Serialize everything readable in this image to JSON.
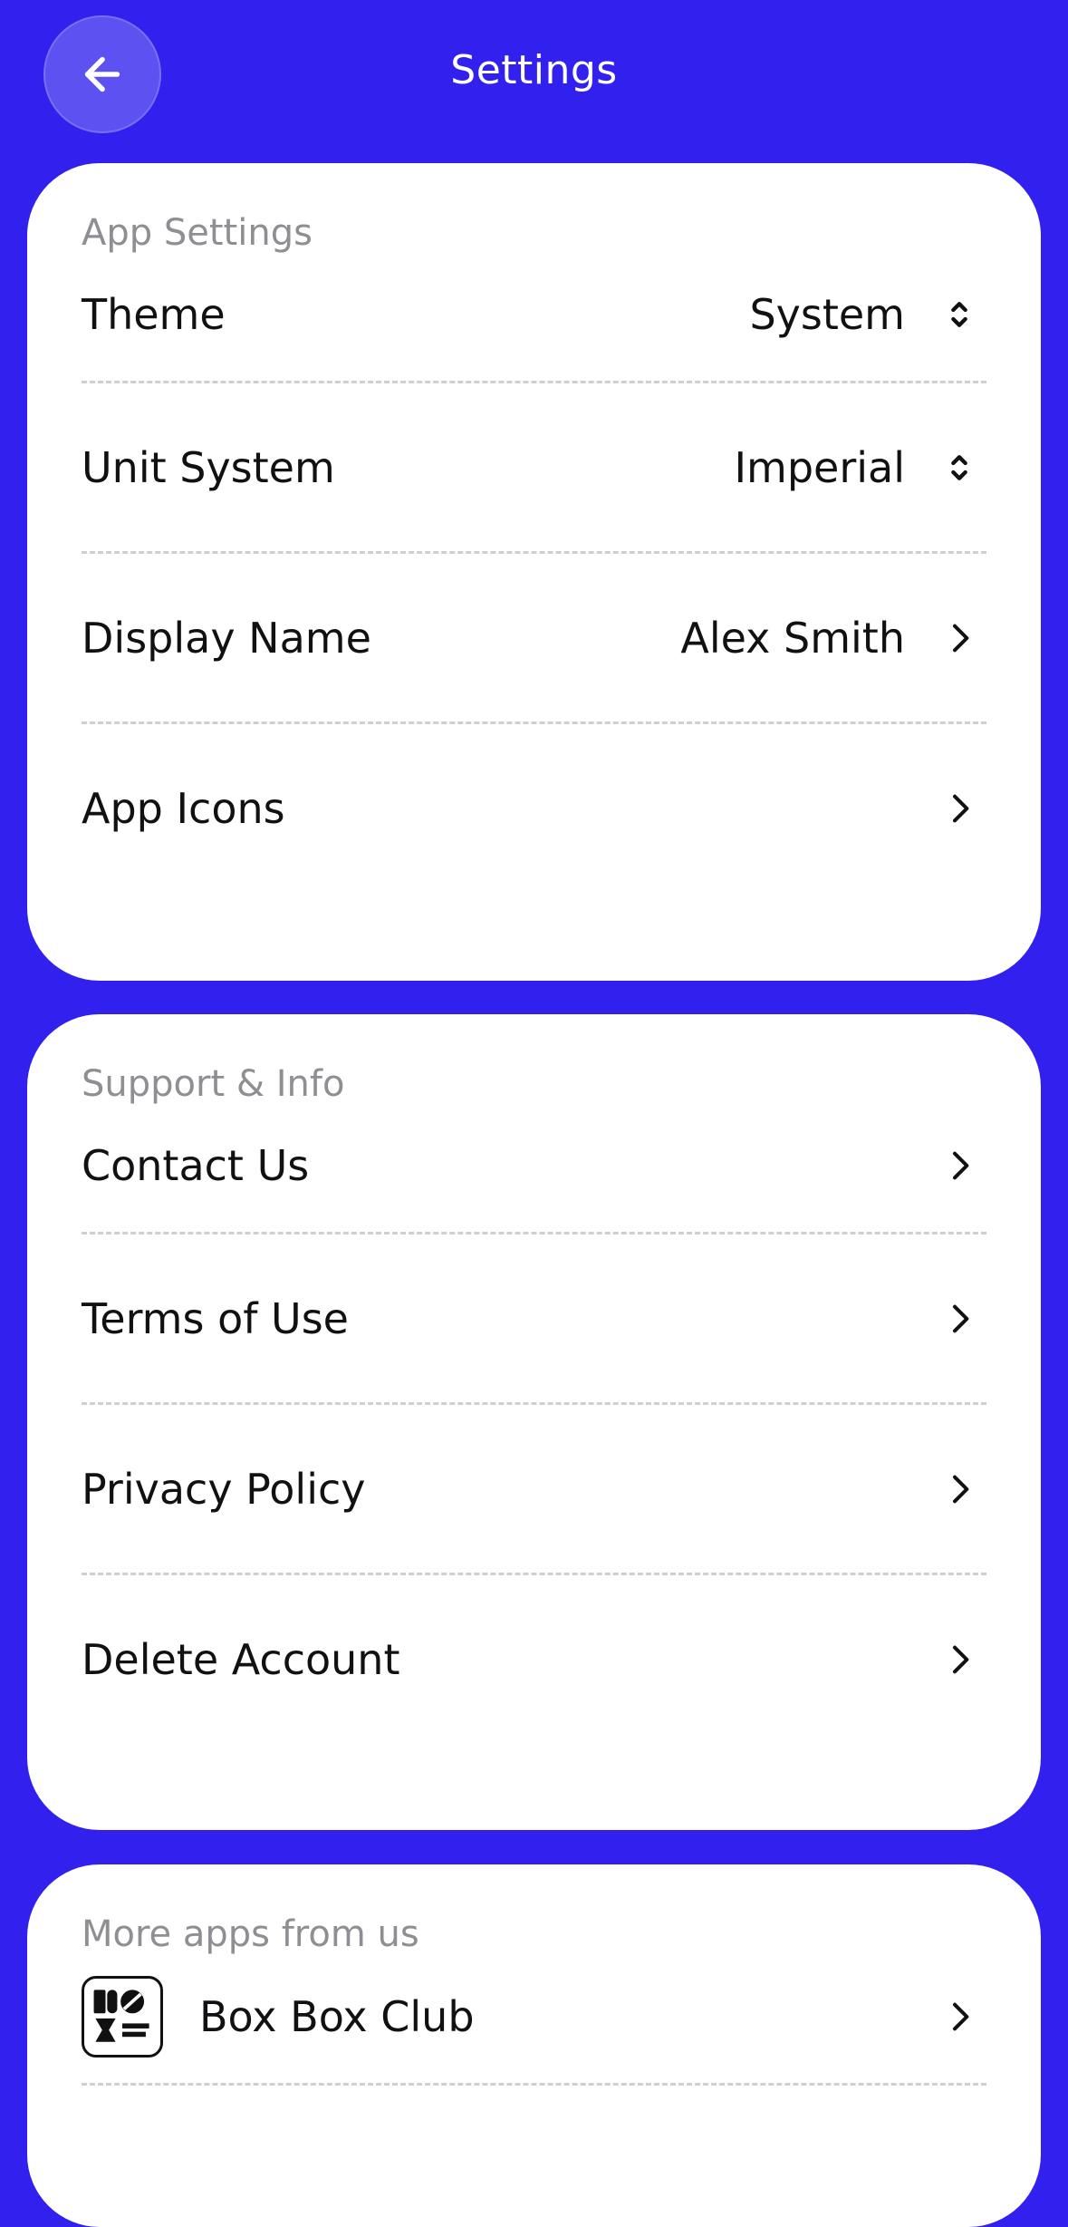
{
  "header": {
    "title": "Settings",
    "back_icon": "arrow-left-icon"
  },
  "colors": {
    "background": "#3120EE",
    "card": "#FFFFFF",
    "section_title": "#8E8E93",
    "text": "#111114"
  },
  "app_settings": {
    "section_title": "App Settings",
    "theme": {
      "label": "Theme",
      "value": "System",
      "icon": "up-down-chevron-icon"
    },
    "unit_system": {
      "label": "Unit System",
      "value": "Imperial",
      "icon": "up-down-chevron-icon"
    },
    "display_name": {
      "label": "Display Name",
      "value": "Alex Smith",
      "icon": "chevron-right-icon"
    },
    "app_icons": {
      "label": "App Icons",
      "icon": "chevron-right-icon"
    }
  },
  "support": {
    "section_title": "Support & Info",
    "contact": {
      "label": "Contact Us"
    },
    "terms": {
      "label": "Terms of Use"
    },
    "privacy": {
      "label": "Privacy Policy"
    },
    "delete": {
      "label": "Delete Account"
    }
  },
  "more_apps": {
    "section_title": "More apps from us",
    "box_box_club": {
      "label": "Box Box Club",
      "logo": "box-box-club-logo"
    }
  }
}
